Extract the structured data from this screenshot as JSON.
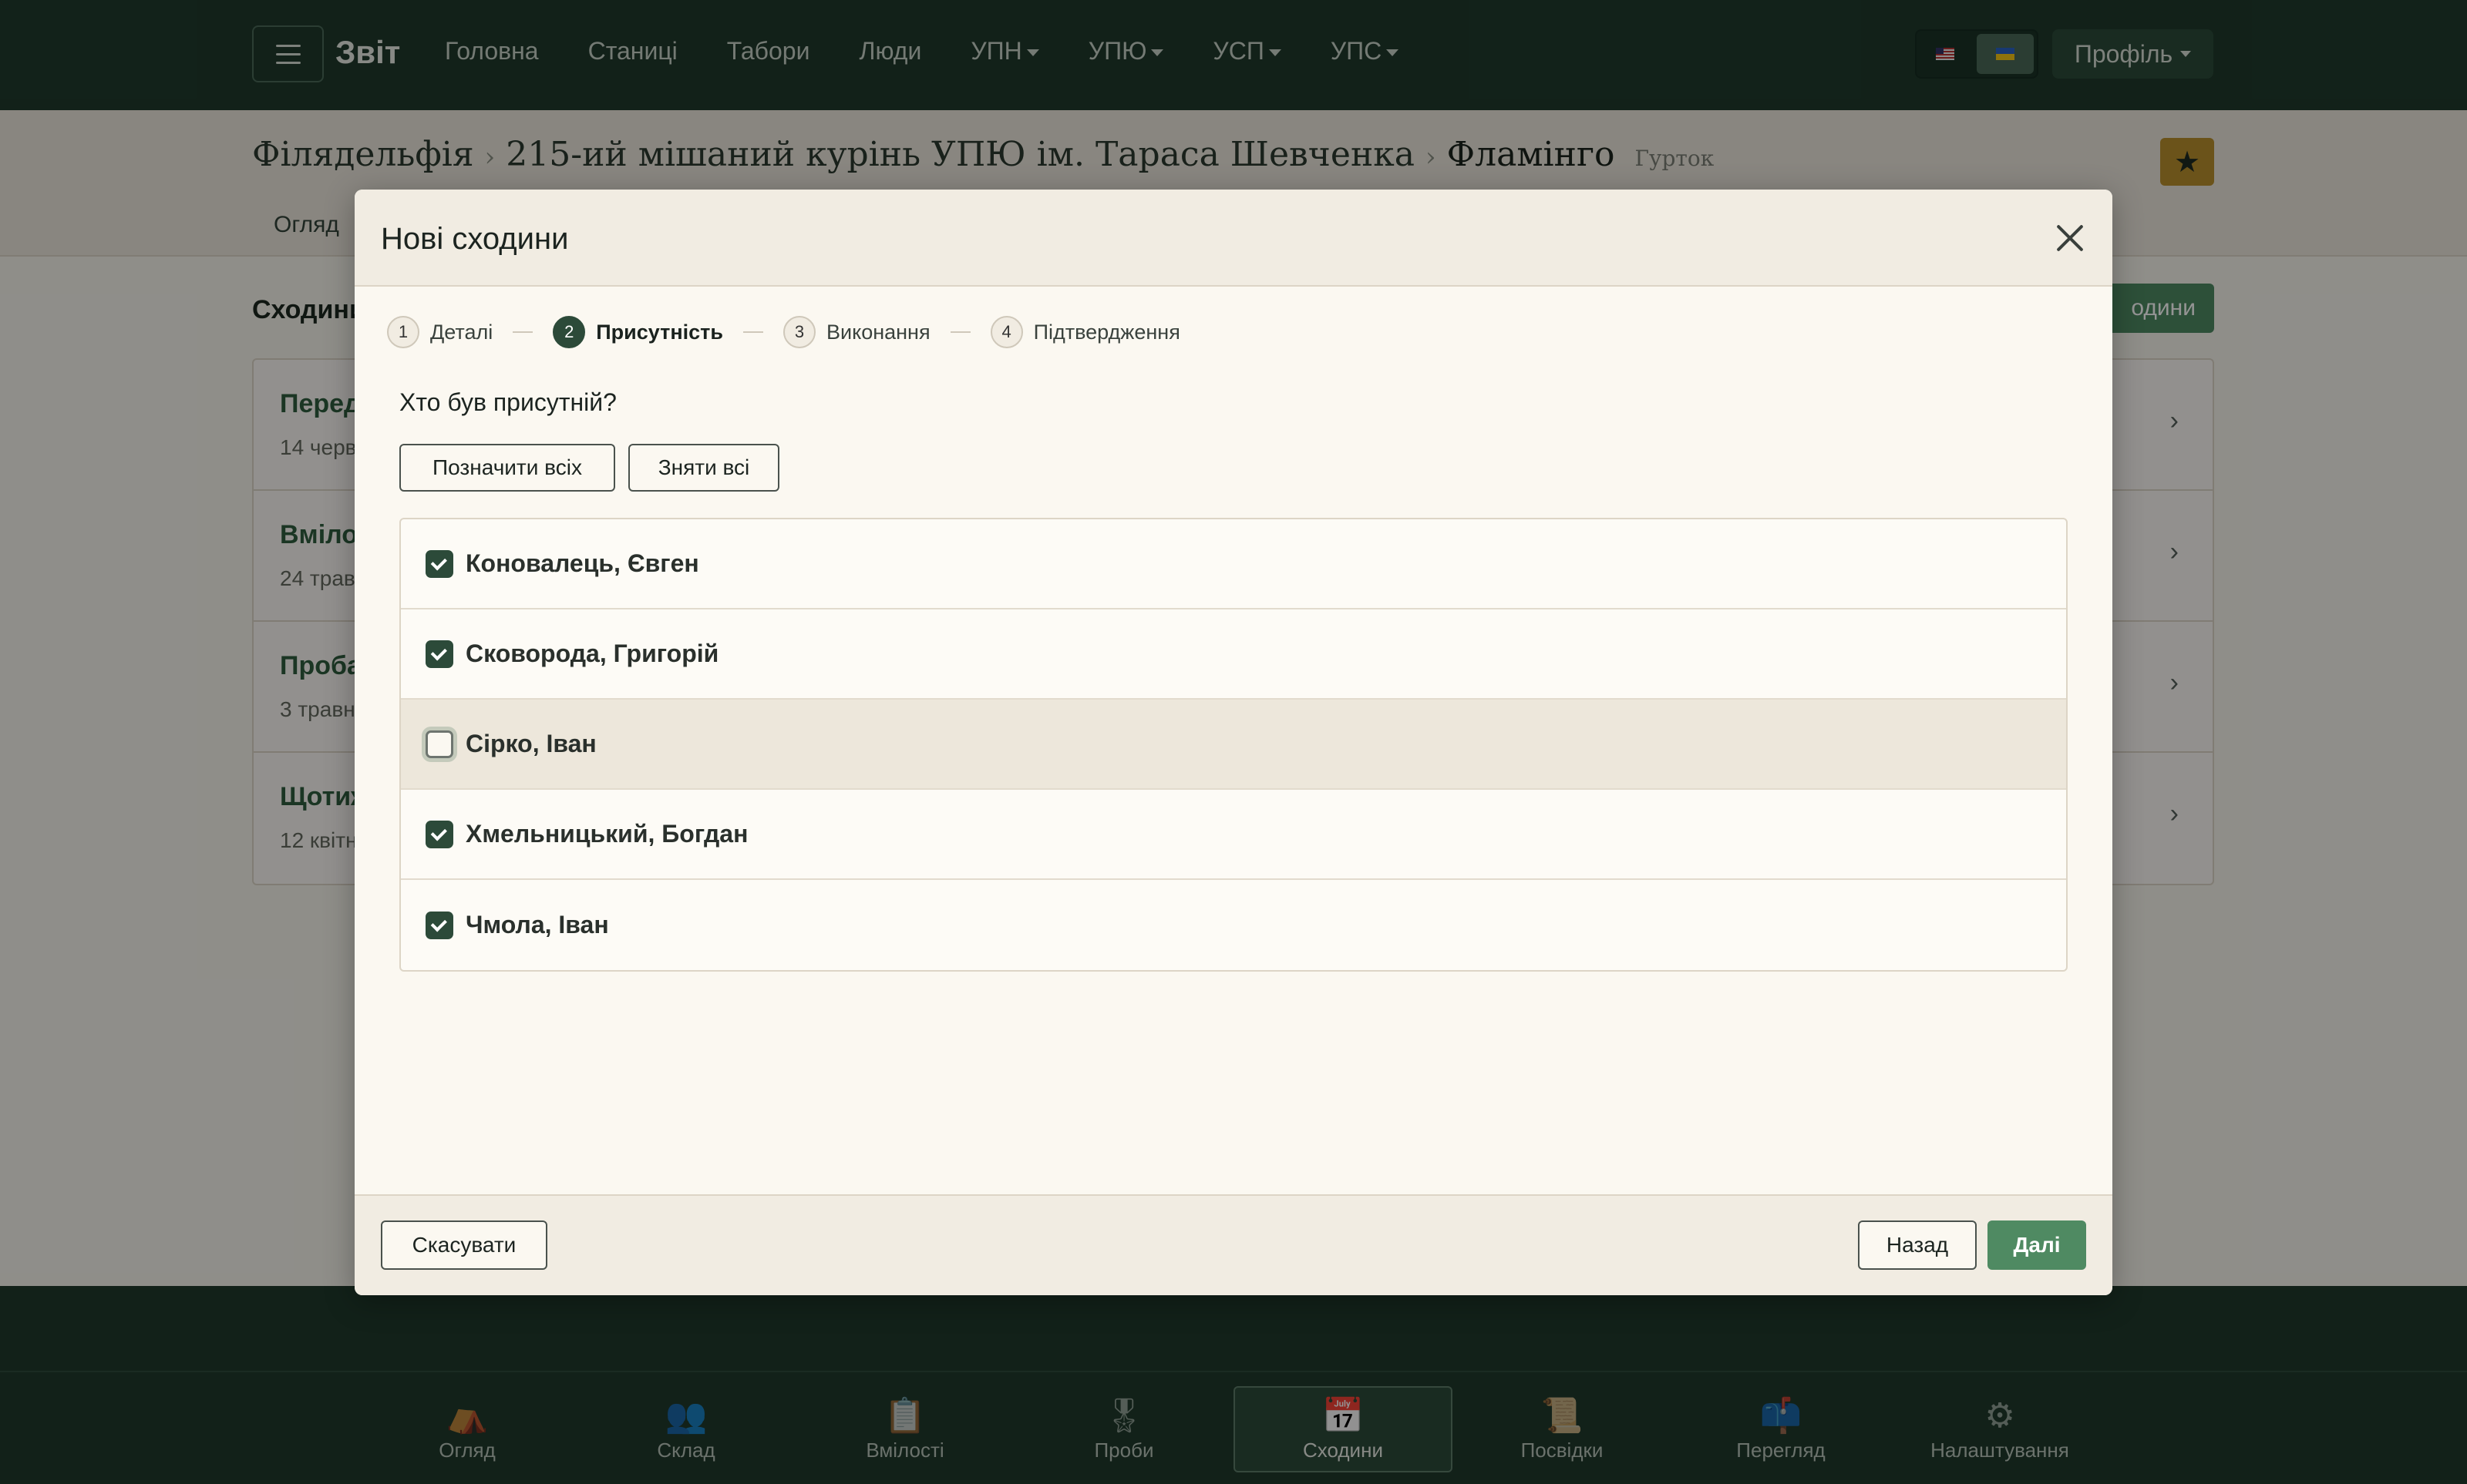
{
  "navbar": {
    "brand": "Звіт",
    "links": [
      "Головна",
      "Станиці",
      "Табори",
      "Люди"
    ],
    "dropdowns": [
      "УПН",
      "УПЮ",
      "УСП",
      "УПС"
    ],
    "languages": [
      "us-flag-icon",
      "ua-flag-icon"
    ],
    "profile_label": "Профіль"
  },
  "page": {
    "breadcrumb": [
      "Філядельфія",
      "215-ий мішаний курінь УПЮ ім. Тараса Шевченка",
      "Фламінго"
    ],
    "group_type": "Гурток",
    "tab": "Огляд",
    "section_title": "Сходини",
    "new_button": "одини",
    "list": [
      {
        "title": "Перед",
        "date": "14 черв"
      },
      {
        "title": "Вміло",
        "date": "24 трав"
      },
      {
        "title": "Проба",
        "date": "3 травн"
      },
      {
        "title": "Щотиж",
        "date": "12 квітн"
      }
    ]
  },
  "modal": {
    "title": "Нові сходини",
    "steps": [
      {
        "num": "1",
        "label": "Деталі"
      },
      {
        "num": "2",
        "label": "Присутність",
        "active": true
      },
      {
        "num": "3",
        "label": "Виконання"
      },
      {
        "num": "4",
        "label": "Підтвердження"
      }
    ],
    "question": "Хто був присутній?",
    "select_all_label": "Позначити всіх",
    "clear_all_label": "Зняти всі",
    "people": [
      {
        "name": "Коновалець, Євген",
        "checked": true
      },
      {
        "name": "Сковорода, Григорій",
        "checked": true
      },
      {
        "name": "Сірко, Іван",
        "checked": false
      },
      {
        "name": "Хмельницький, Богдан",
        "checked": true
      },
      {
        "name": "Чмола, Іван",
        "checked": true
      }
    ],
    "cancel_label": "Скасувати",
    "back_label": "Назад",
    "next_label": "Далі"
  },
  "tabbar": {
    "tabs": [
      {
        "label": "Огляд",
        "icon": "campfire-icon",
        "glyph": "⛺"
      },
      {
        "label": "Склад",
        "icon": "people-icon",
        "glyph": "👥"
      },
      {
        "label": "Вмілості",
        "icon": "clipboard-icon",
        "glyph": "📋"
      },
      {
        "label": "Проби",
        "icon": "medal-icon",
        "glyph": "🎖"
      },
      {
        "label": "Сходини",
        "icon": "calendar-icon",
        "glyph": "📅",
        "active": true
      },
      {
        "label": "Посвідки",
        "icon": "scroll-icon",
        "glyph": "📜"
      },
      {
        "label": "Перегляд",
        "icon": "mailbox-icon",
        "glyph": "📫"
      },
      {
        "label": "Налаштування",
        "icon": "gear-icon",
        "glyph": "⚙"
      }
    ]
  },
  "colors": {
    "navbar": "#1f3a2c",
    "accent_green": "#4f8a62",
    "star_gold": "#b8902e"
  }
}
